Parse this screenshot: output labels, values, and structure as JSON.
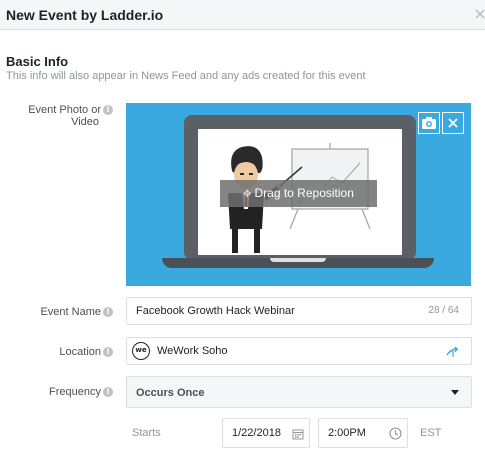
{
  "dialog": {
    "title": "New Event by Ladder.io"
  },
  "section": {
    "title": "Basic Info",
    "subtitle": "This info will also appear in News Feed and any ads created for this event"
  },
  "fields": {
    "photo_label_line1": "Event Photo or",
    "photo_label_line2": "Video",
    "drag_text": "Drag to Reposition",
    "event_name_label": "Event Name",
    "event_name_value": "Facebook Growth Hack Webinar",
    "event_name_counter": "28 / 64",
    "location_label": "Location",
    "location_logo_text": "we",
    "location_value": "WeWork Soho",
    "frequency_label": "Frequency",
    "frequency_value": "Occurs Once",
    "starts_label": "Starts",
    "start_date": "1/22/2018",
    "start_time": "2:00PM",
    "timezone": "EST",
    "info_glyph": "i"
  },
  "colors": {
    "photo_background": "#3aa9df",
    "header_background": "#f5f6f7"
  }
}
